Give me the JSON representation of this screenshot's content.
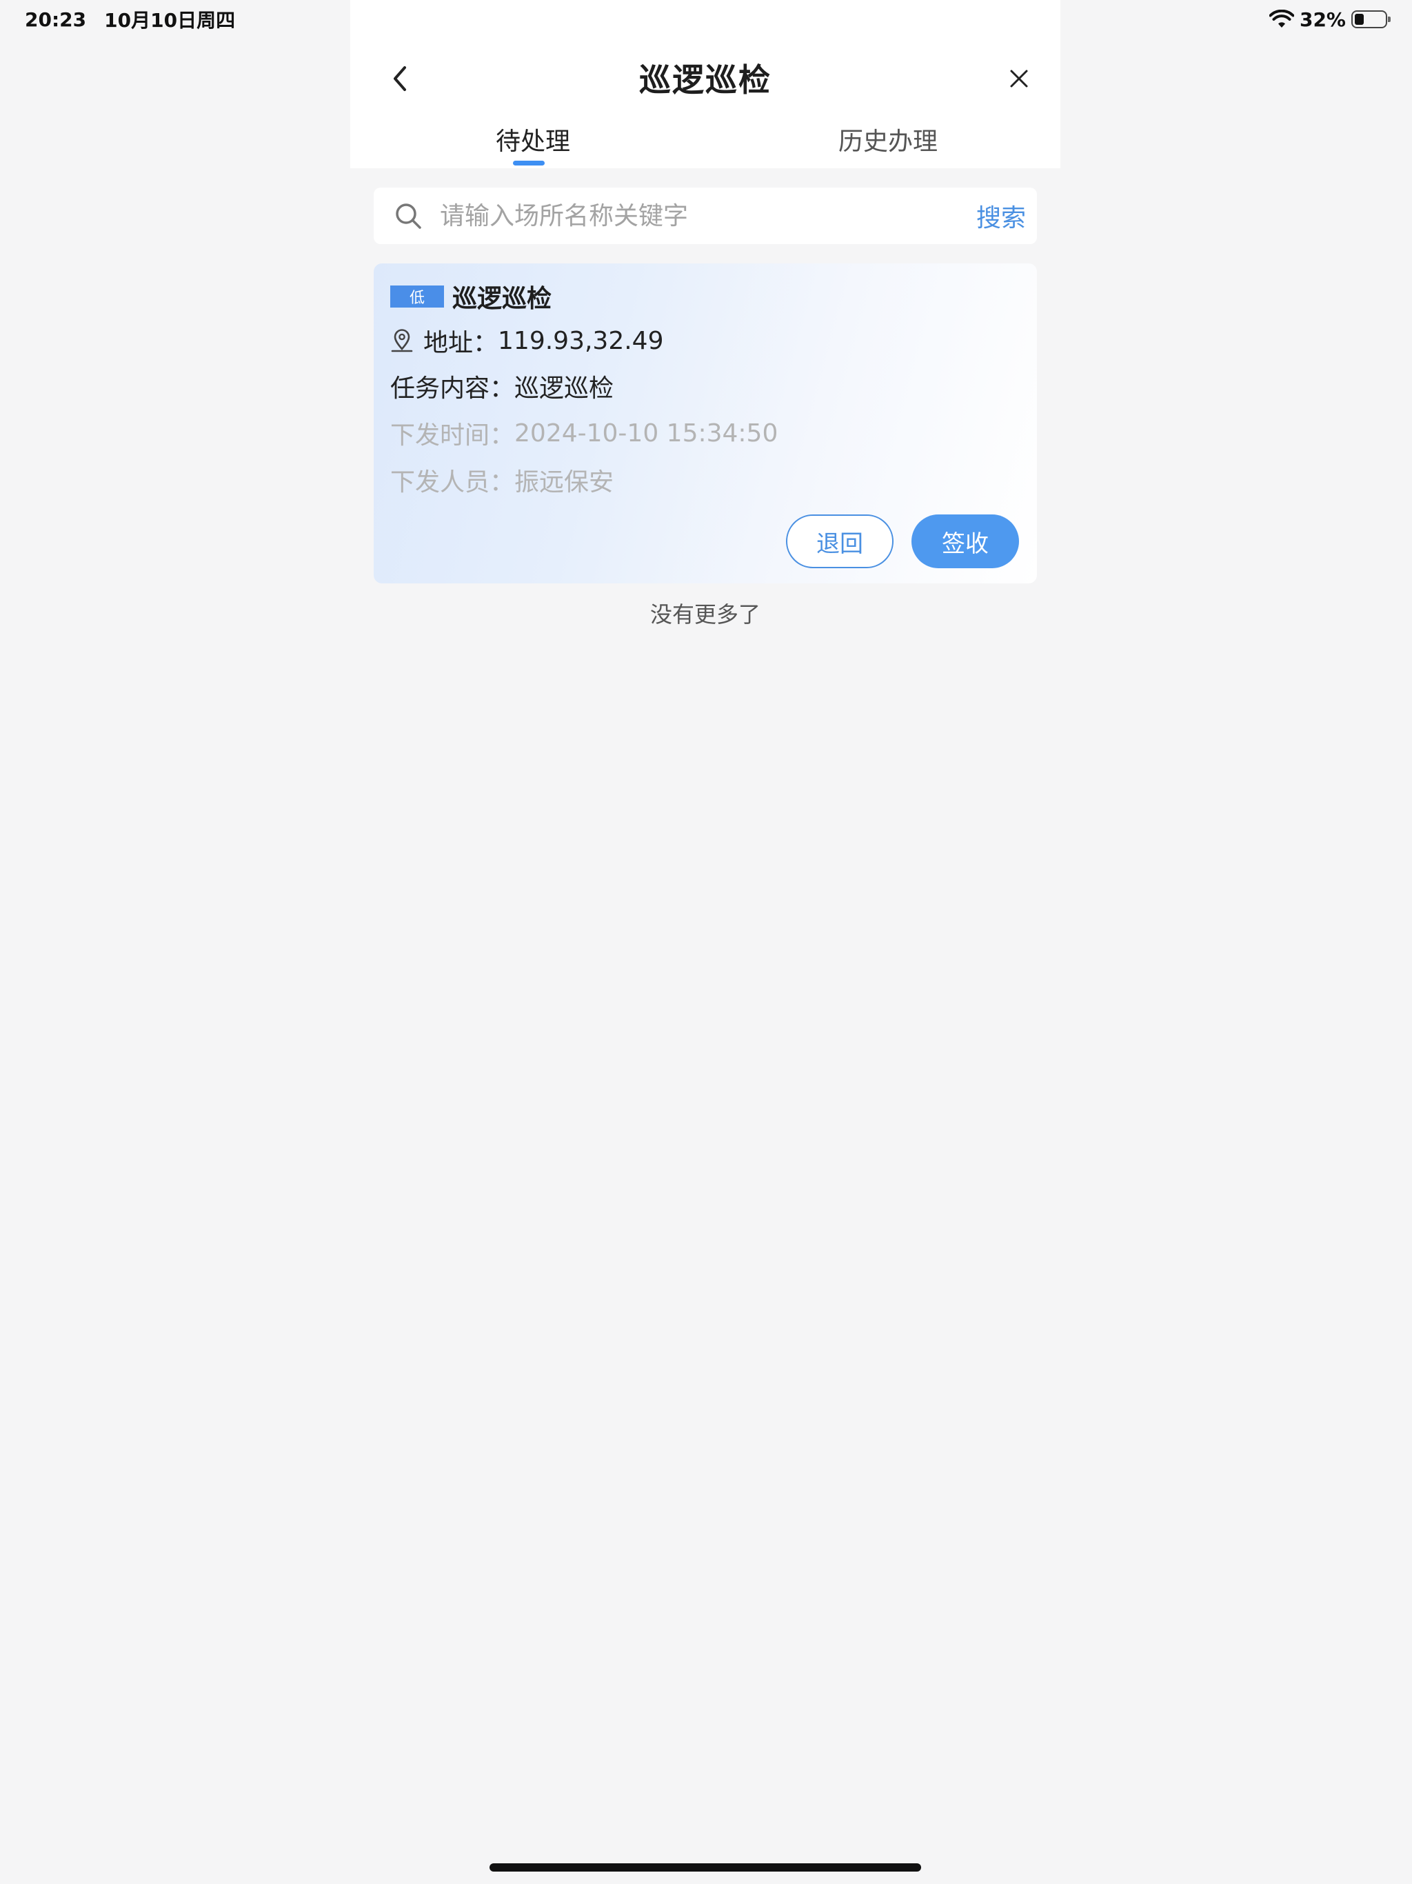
{
  "status_bar": {
    "time": "20:23",
    "date": "10月10日周四",
    "battery_percent": "32%",
    "battery_level": 0.32
  },
  "header": {
    "title": "巡逻巡检",
    "back_icon": "chevron-left-icon",
    "close_icon": "close-icon"
  },
  "tabs": [
    {
      "label": "待处理",
      "active": true
    },
    {
      "label": "历史办理",
      "active": false
    }
  ],
  "search": {
    "placeholder": "请输入场所名称关键字",
    "value": "",
    "button_label": "搜索",
    "icon": "search-icon"
  },
  "task_card": {
    "priority": "低",
    "title": "巡逻巡检",
    "address_label": "地址：",
    "address_value": "119.93,32.49",
    "content_label": "任务内容：",
    "content_value": "巡逻巡检",
    "time_label": "下发时间：",
    "time_value": "2024-10-10 15:34:50",
    "person_label": "下发人员：",
    "person_value": "振远保安",
    "return_button": "退回",
    "sign_button": "签收"
  },
  "list_footer": "没有更多了",
  "colors": {
    "accent": "#4a90e2",
    "badge": "#4a8ee8",
    "background": "#f5f5f6"
  }
}
